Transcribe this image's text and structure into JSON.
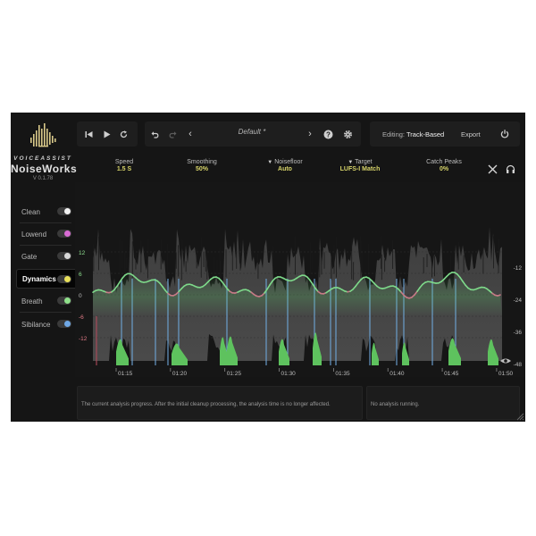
{
  "brand": {
    "super": "VOICEASSIST",
    "name": "NoiseWorks",
    "version": "V 0.1.78"
  },
  "modules": [
    {
      "label": "Clean",
      "dot": "#f2f2f2",
      "active": false
    },
    {
      "label": "Lowend",
      "dot": "#d96bd4",
      "active": false
    },
    {
      "label": "Gate",
      "dot": "#d9d9d9",
      "active": false
    },
    {
      "label": "Dynamics",
      "dot": "#e8e05a",
      "active": true
    },
    {
      "label": "Breath",
      "dot": "#8fe08a",
      "active": false
    },
    {
      "label": "Sibilance",
      "dot": "#6fa8e6",
      "active": false
    }
  ],
  "toolbar": {
    "preset": "Default *",
    "editing_label": "Editing:",
    "editing_value": "Track-Based",
    "export_label": "Export"
  },
  "params": [
    {
      "label": "Speed",
      "value": "1.5 S",
      "dropdown": false
    },
    {
      "label": "Smoothing",
      "value": "50%",
      "dropdown": false
    },
    {
      "label": "Noisefloor",
      "value": "Auto",
      "dropdown": true
    },
    {
      "label": "Target",
      "value": "LUFS-I Match",
      "dropdown": true
    },
    {
      "label": "Catch Peaks",
      "value": "0%",
      "dropdown": false
    }
  ],
  "graph": {
    "left_ticks": [
      "12",
      "6",
      "0",
      "-6",
      "-12"
    ],
    "right_ticks": [
      "-12",
      "-24",
      "-36",
      "-48"
    ],
    "time_ticks": [
      "01:15",
      "01:20",
      "01:25",
      "01:30",
      "01:35",
      "01:40",
      "01:45",
      "01:50"
    ],
    "colors": {
      "gain_up": "#7ed98a",
      "gain_down": "#c77a86",
      "markers": "#6ea6d8",
      "breath": "#5ec25e"
    }
  },
  "info": {
    "left": "The current analysis progress. After the initial cleanup processing, the analysis time is no longer affected.",
    "right": "No analysis running."
  }
}
